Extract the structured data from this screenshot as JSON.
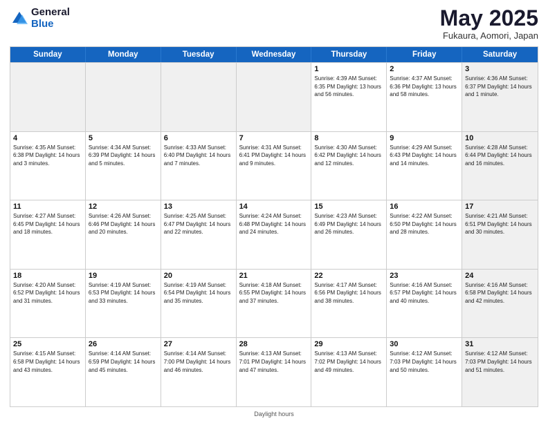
{
  "header": {
    "logo_general": "General",
    "logo_blue": "Blue",
    "month_title": "May 2025",
    "subtitle": "Fukaura, Aomori, Japan"
  },
  "days_of_week": [
    "Sunday",
    "Monday",
    "Tuesday",
    "Wednesday",
    "Thursday",
    "Friday",
    "Saturday"
  ],
  "footer_text": "Daylight hours",
  "weeks": [
    [
      {
        "day": "",
        "info": "",
        "shaded": true
      },
      {
        "day": "",
        "info": "",
        "shaded": true
      },
      {
        "day": "",
        "info": "",
        "shaded": true
      },
      {
        "day": "",
        "info": "",
        "shaded": true
      },
      {
        "day": "1",
        "info": "Sunrise: 4:39 AM\nSunset: 6:35 PM\nDaylight: 13 hours\nand 56 minutes."
      },
      {
        "day": "2",
        "info": "Sunrise: 4:37 AM\nSunset: 6:36 PM\nDaylight: 13 hours\nand 58 minutes."
      },
      {
        "day": "3",
        "info": "Sunrise: 4:36 AM\nSunset: 6:37 PM\nDaylight: 14 hours\nand 1 minute.",
        "shaded": true
      }
    ],
    [
      {
        "day": "4",
        "info": "Sunrise: 4:35 AM\nSunset: 6:38 PM\nDaylight: 14 hours\nand 3 minutes."
      },
      {
        "day": "5",
        "info": "Sunrise: 4:34 AM\nSunset: 6:39 PM\nDaylight: 14 hours\nand 5 minutes."
      },
      {
        "day": "6",
        "info": "Sunrise: 4:33 AM\nSunset: 6:40 PM\nDaylight: 14 hours\nand 7 minutes."
      },
      {
        "day": "7",
        "info": "Sunrise: 4:31 AM\nSunset: 6:41 PM\nDaylight: 14 hours\nand 9 minutes."
      },
      {
        "day": "8",
        "info": "Sunrise: 4:30 AM\nSunset: 6:42 PM\nDaylight: 14 hours\nand 12 minutes."
      },
      {
        "day": "9",
        "info": "Sunrise: 4:29 AM\nSunset: 6:43 PM\nDaylight: 14 hours\nand 14 minutes."
      },
      {
        "day": "10",
        "info": "Sunrise: 4:28 AM\nSunset: 6:44 PM\nDaylight: 14 hours\nand 16 minutes.",
        "shaded": true
      }
    ],
    [
      {
        "day": "11",
        "info": "Sunrise: 4:27 AM\nSunset: 6:45 PM\nDaylight: 14 hours\nand 18 minutes."
      },
      {
        "day": "12",
        "info": "Sunrise: 4:26 AM\nSunset: 6:46 PM\nDaylight: 14 hours\nand 20 minutes."
      },
      {
        "day": "13",
        "info": "Sunrise: 4:25 AM\nSunset: 6:47 PM\nDaylight: 14 hours\nand 22 minutes."
      },
      {
        "day": "14",
        "info": "Sunrise: 4:24 AM\nSunset: 6:48 PM\nDaylight: 14 hours\nand 24 minutes."
      },
      {
        "day": "15",
        "info": "Sunrise: 4:23 AM\nSunset: 6:49 PM\nDaylight: 14 hours\nand 26 minutes."
      },
      {
        "day": "16",
        "info": "Sunrise: 4:22 AM\nSunset: 6:50 PM\nDaylight: 14 hours\nand 28 minutes."
      },
      {
        "day": "17",
        "info": "Sunrise: 4:21 AM\nSunset: 6:51 PM\nDaylight: 14 hours\nand 30 minutes.",
        "shaded": true
      }
    ],
    [
      {
        "day": "18",
        "info": "Sunrise: 4:20 AM\nSunset: 6:52 PM\nDaylight: 14 hours\nand 31 minutes."
      },
      {
        "day": "19",
        "info": "Sunrise: 4:19 AM\nSunset: 6:53 PM\nDaylight: 14 hours\nand 33 minutes."
      },
      {
        "day": "20",
        "info": "Sunrise: 4:19 AM\nSunset: 6:54 PM\nDaylight: 14 hours\nand 35 minutes."
      },
      {
        "day": "21",
        "info": "Sunrise: 4:18 AM\nSunset: 6:55 PM\nDaylight: 14 hours\nand 37 minutes."
      },
      {
        "day": "22",
        "info": "Sunrise: 4:17 AM\nSunset: 6:56 PM\nDaylight: 14 hours\nand 38 minutes."
      },
      {
        "day": "23",
        "info": "Sunrise: 4:16 AM\nSunset: 6:57 PM\nDaylight: 14 hours\nand 40 minutes."
      },
      {
        "day": "24",
        "info": "Sunrise: 4:16 AM\nSunset: 6:58 PM\nDaylight: 14 hours\nand 42 minutes.",
        "shaded": true
      }
    ],
    [
      {
        "day": "25",
        "info": "Sunrise: 4:15 AM\nSunset: 6:58 PM\nDaylight: 14 hours\nand 43 minutes."
      },
      {
        "day": "26",
        "info": "Sunrise: 4:14 AM\nSunset: 6:59 PM\nDaylight: 14 hours\nand 45 minutes."
      },
      {
        "day": "27",
        "info": "Sunrise: 4:14 AM\nSunset: 7:00 PM\nDaylight: 14 hours\nand 46 minutes."
      },
      {
        "day": "28",
        "info": "Sunrise: 4:13 AM\nSunset: 7:01 PM\nDaylight: 14 hours\nand 47 minutes."
      },
      {
        "day": "29",
        "info": "Sunrise: 4:13 AM\nSunset: 7:02 PM\nDaylight: 14 hours\nand 49 minutes."
      },
      {
        "day": "30",
        "info": "Sunrise: 4:12 AM\nSunset: 7:03 PM\nDaylight: 14 hours\nand 50 minutes."
      },
      {
        "day": "31",
        "info": "Sunrise: 4:12 AM\nSunset: 7:03 PM\nDaylight: 14 hours\nand 51 minutes.",
        "shaded": true
      }
    ]
  ]
}
